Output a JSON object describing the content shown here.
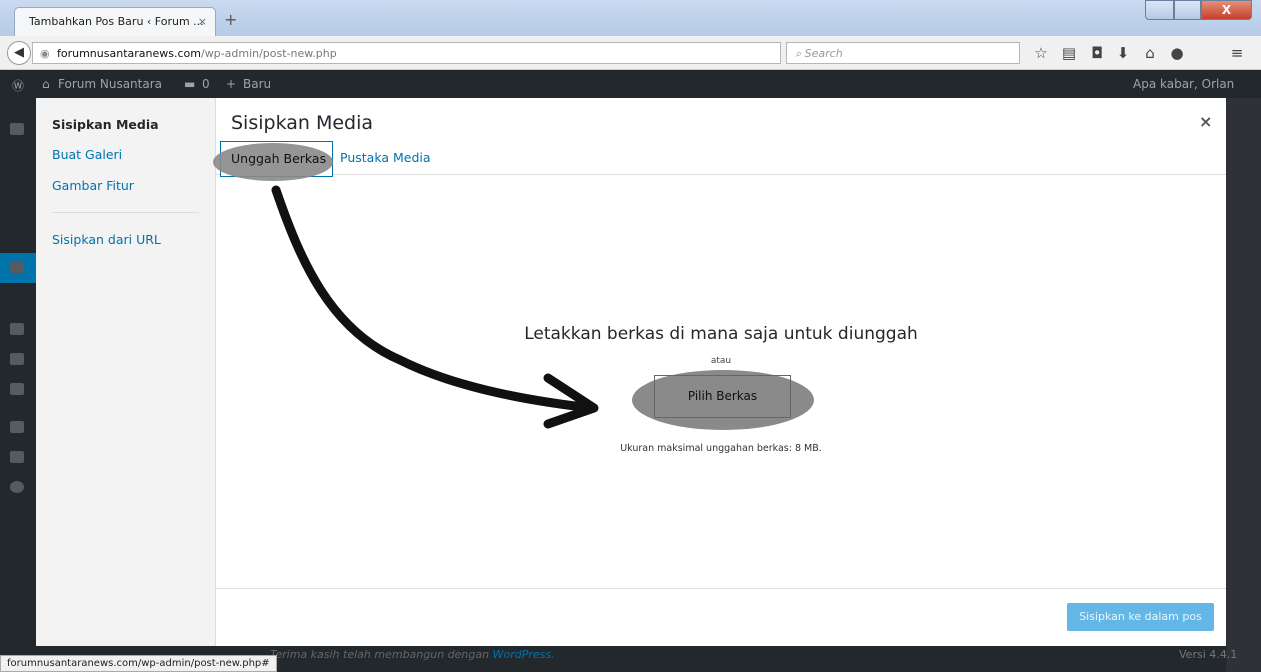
{
  "browser": {
    "tab_title": "Tambahkan Pos Baru ‹ Forum ...",
    "tab_close": "×",
    "new_tab": "+",
    "window_close": "X",
    "url_domain": "forumnusantaranews.com",
    "url_path": "/wp-admin/post-new.php",
    "search_placeholder": "Search",
    "status_url": "forumnusantaranews.com/wp-admin/post-new.php#"
  },
  "adminbar": {
    "site_name": "Forum Nusantara",
    "comments_count": "0",
    "new_label": "Baru",
    "greeting": "Apa kabar, Orlan"
  },
  "modal": {
    "menu": {
      "items": [
        {
          "label": "Sisipkan Media"
        },
        {
          "label": "Buat Galeri"
        },
        {
          "label": "Gambar Fitur"
        }
      ],
      "url_item": "Sisipkan dari URL"
    },
    "title": "Sisipkan Media",
    "close": "×",
    "tabs": {
      "upload": "Unggah Berkas",
      "library": "Pustaka Media"
    },
    "uploader": {
      "instructions": "Letakkan berkas di mana saja untuk diunggah",
      "or": "atau",
      "select_button": "Pilih Berkas",
      "max_size": "Ukuran maksimal unggahan berkas: 8 MB."
    },
    "insert_button": "Sisipkan ke dalam pos"
  },
  "footer": {
    "credit": "Terima kasih telah membangun dengan",
    "credit_link": "WordPress.",
    "version": "Versi 4.4.1"
  },
  "colors": {
    "accent": "#0073aa",
    "button_primary": "#62b7e6",
    "annotation": "#8a8a8a"
  }
}
